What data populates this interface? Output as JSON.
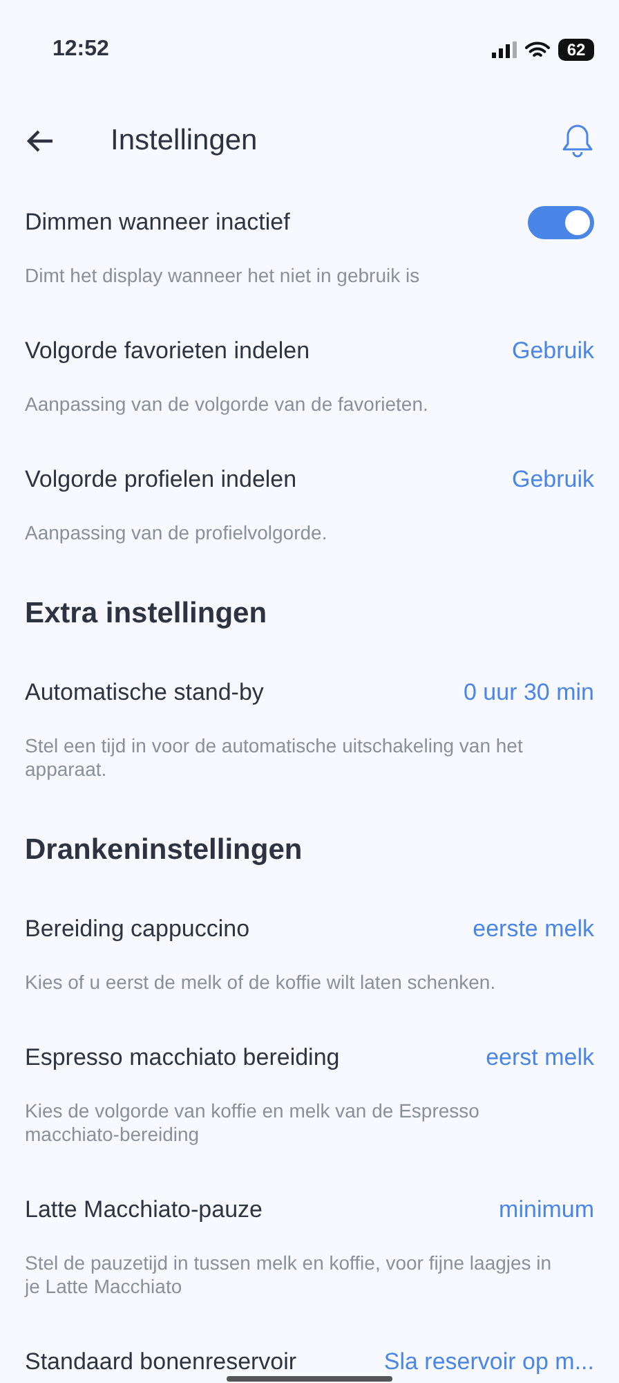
{
  "status_bar": {
    "time": "12:52",
    "battery": "62"
  },
  "header": {
    "title": "Instellingen"
  },
  "items": [
    {
      "kind": "toggle",
      "title": "Dimmen wanneer inactief",
      "on": true,
      "description": "Dimt het display wanneer het niet in gebruik is"
    },
    {
      "kind": "value",
      "title": "Volgorde favorieten indelen",
      "value": "Gebruik",
      "description": "Aanpassing van de volgorde van de favorieten."
    },
    {
      "kind": "value",
      "title": "Volgorde profielen indelen",
      "value": "Gebruik",
      "description": "Aanpassing van de profielvolgorde."
    },
    {
      "kind": "section",
      "title": "Extra instellingen"
    },
    {
      "kind": "value",
      "title": "Automatische stand-by",
      "value": "0 uur 30 min",
      "description": "Stel een tijd in voor de automatische uitschakeling van het apparaat."
    },
    {
      "kind": "section",
      "title": "Drankeninstellingen"
    },
    {
      "kind": "value",
      "title": "Bereiding cappuccino",
      "value": "eerste melk",
      "description": "Kies of u eerst de melk of de koffie wilt laten schenken."
    },
    {
      "kind": "value",
      "title": "Espresso macchiato bereiding",
      "value": "eerst melk",
      "description": "Kies de volgorde van koffie en melk van de Espresso macchiato-bereiding"
    },
    {
      "kind": "value",
      "title": "Latte Macchiato-pauze",
      "value": "minimum",
      "description": "Stel de pauzetijd in tussen melk en koffie, voor fijne laagjes in je Latte Macchiato"
    },
    {
      "kind": "value",
      "title": "Standaard bonenreservoir",
      "value": "Sla reservoir op m..."
    }
  ]
}
